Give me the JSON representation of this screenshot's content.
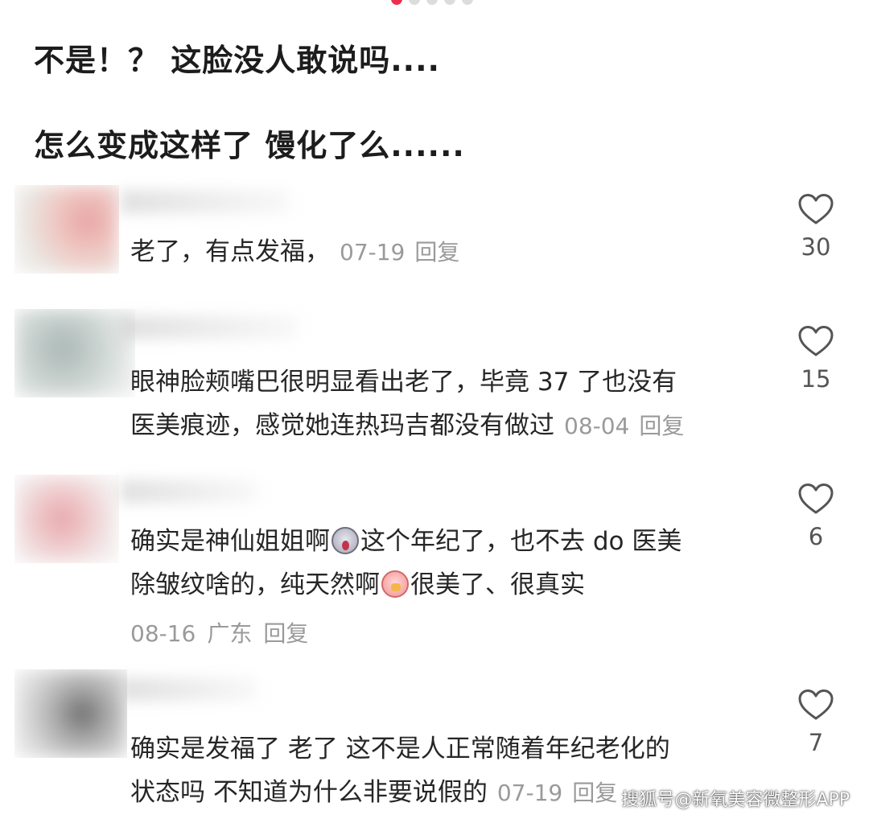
{
  "post": {
    "title_line1": "不是！？ 这脸没人敢说吗....",
    "title_line2": "怎么变成这样了 馒化了么......"
  },
  "colors": {
    "accent_dot": "#ee2e4f",
    "meta_gray": "#9a9a9a"
  },
  "comments": [
    {
      "text": "老了，有点发福，",
      "date": "07-19",
      "reply": "回复",
      "likes": "30"
    },
    {
      "text_line1": "眼神脸颊嘴巴很明显看出老了，毕竟 37 了也没有",
      "text_line2": "医美痕迹，感觉她连热玛吉都没有做过",
      "date": "08-04",
      "reply": "回复",
      "likes": "15"
    },
    {
      "text_line1_a": "确实是神仙姐姐啊",
      "text_line1_b": "这个年纪了，也不去 do 医美",
      "text_line2_a": "除皱纹啥的，纯天然啊",
      "text_line2_b": "很美了、很真实",
      "date": "08-16",
      "location": "广东",
      "reply": "回复",
      "likes": "6",
      "emoji_1": "scream-emoji-icon",
      "emoji_2": "peach-emoji-icon"
    },
    {
      "text_line1": "确实是发福了 老了 这不是人正常随着年纪老化的",
      "text_line2": "状态吗 不知道为什么非要说假的",
      "date": "07-19",
      "reply": "回复",
      "likes": "7"
    }
  ],
  "watermark": "搜狐号@新氧美容微整形APP"
}
